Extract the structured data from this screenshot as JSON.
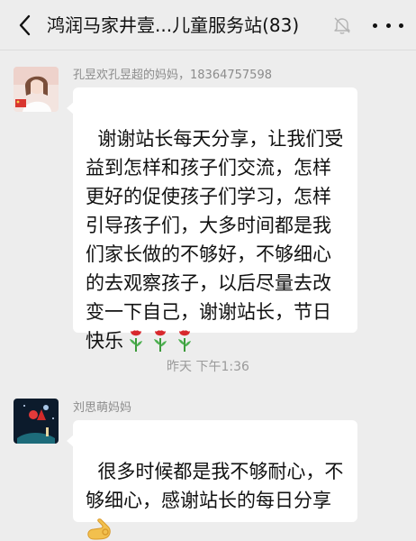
{
  "header": {
    "title": "鸿润马家井壹...儿童服务站(83)",
    "back_icon": "chevron-left-icon",
    "mute_icon": "bell-muted-icon",
    "more_icon": "more-dots-icon"
  },
  "messages": [
    {
      "sender": "孔昱欢孔昱超的妈妈，18364757598",
      "text": "谢谢站长每天分享，让我们受益到怎样和孩子们交流，怎样更好的促使孩子们学习，怎样引导孩子们，大多时间都是我们家长做的不够好，不够细心的去观察孩子，以后尽量去改变一下自己，谢谢站长，节日快乐",
      "emoji": [
        "rose-icon",
        "rose-icon",
        "rose-icon"
      ]
    },
    {
      "sender": "刘思萌妈妈",
      "text": "很多时候都是我不够耐心，不够细心，感谢站长的每日分享",
      "emoji": [
        "ok-hand-icon"
      ]
    }
  ],
  "timestamp": "昨天 下午1:36",
  "colors": {
    "background": "#ededed",
    "bubble": "#ffffff",
    "sender_name": "#8c8c8c",
    "timestamp": "#9a9a9a"
  }
}
